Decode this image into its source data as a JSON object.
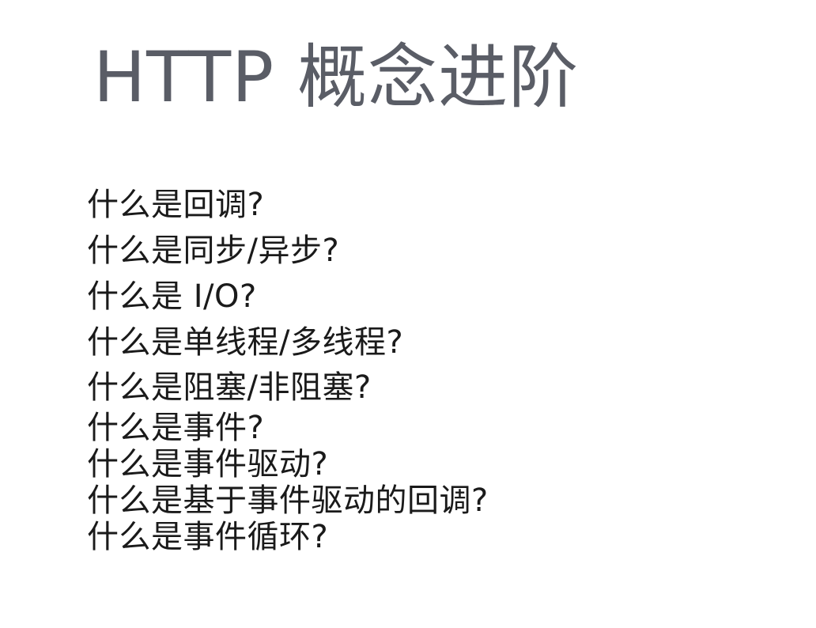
{
  "slide": {
    "title": "HTTP 概念进阶",
    "questions": [
      "什么是回调?",
      "什么是同步/异步?",
      "什么是 I/O?",
      "什么是单线程/多线程?",
      "什么是阻塞/非阻塞?",
      "什么是事件?",
      "什么是事件驱动?",
      "什么是基于事件驱动的回调?",
      "什么是事件循环?"
    ]
  },
  "colors": {
    "background": "#ffffff",
    "title": "#5a5d66",
    "text": "#1a1a1a"
  }
}
